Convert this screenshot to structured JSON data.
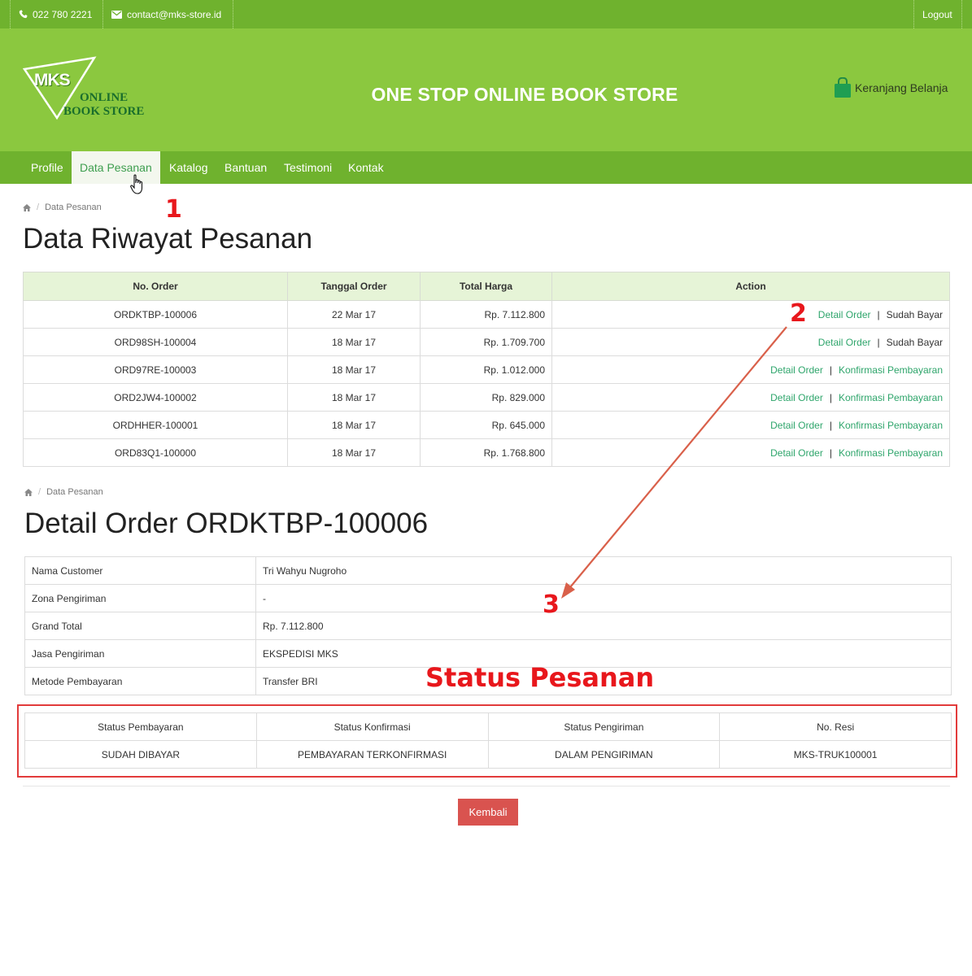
{
  "topbar": {
    "phone": "022 780 2221",
    "email": "contact@mks-store.id",
    "logout": "Logout"
  },
  "header": {
    "logo_mark": "MKS",
    "logo_line1": "ONLINE",
    "logo_line2": "BOOK STORE",
    "tagline": "ONE STOP ONLINE BOOK STORE",
    "cart_label": "Keranjang Belanja"
  },
  "nav": {
    "items": [
      "Profile",
      "Data Pesanan",
      "Katalog",
      "Bantuan",
      "Testimoni",
      "Kontak"
    ],
    "active": "Data Pesanan"
  },
  "breadcrumb": {
    "current": "Data Pesanan"
  },
  "orders_section": {
    "title": "Data Riwayat Pesanan",
    "headers": [
      "No. Order",
      "Tanggal Order",
      "Total Harga",
      "Action"
    ],
    "rows": [
      {
        "no": "ORDKTBP-100006",
        "date": "22 Mar 17",
        "total": "Rp. 7.112.800",
        "detail": "Detail Order",
        "status": "Sudah Bayar"
      },
      {
        "no": "ORD98SH-100004",
        "date": "18 Mar 17",
        "total": "Rp. 1.709.700",
        "detail": "Detail Order",
        "status": "Sudah Bayar"
      },
      {
        "no": "ORD97RE-100003",
        "date": "18 Mar 17",
        "total": "Rp. 1.012.000",
        "detail": "Detail Order",
        "status": "Konfirmasi Pembayaran"
      },
      {
        "no": "ORD2JW4-100002",
        "date": "18 Mar 17",
        "total": "Rp. 829.000",
        "detail": "Detail Order",
        "status": "Konfirmasi Pembayaran"
      },
      {
        "no": "ORDHHER-100001",
        "date": "18 Mar 17",
        "total": "Rp. 645.000",
        "detail": "Detail Order",
        "status": "Konfirmasi Pembayaran"
      },
      {
        "no": "ORD83Q1-100000",
        "date": "18 Mar 17",
        "total": "Rp. 1.768.800",
        "detail": "Detail Order",
        "status": "Konfirmasi Pembayaran"
      }
    ]
  },
  "detail_section": {
    "title": "Detail Order ORDKTBP-100006",
    "fields": [
      {
        "label": "Nama Customer",
        "value": "Tri Wahyu Nugroho"
      },
      {
        "label": "Zona Pengiriman",
        "value": "-"
      },
      {
        "label": "Grand Total",
        "value": "Rp. 7.112.800"
      },
      {
        "label": "Jasa Pengiriman",
        "value": "EKSPEDISI MKS"
      },
      {
        "label": "Metode Pembayaran",
        "value": "Transfer BRI"
      }
    ],
    "status_headers": [
      "Status Pembayaran",
      "Status Konfirmasi",
      "Status Pengiriman",
      "No. Resi"
    ],
    "status_values": [
      "SUDAH DIBAYAR",
      "PEMBAYARAN TERKONFIRMASI",
      "DALAM PENGIRIMAN",
      "MKS-TRUK100001"
    ],
    "back_button": "Kembali"
  },
  "annotations": {
    "n1": "1",
    "n2": "2",
    "n3": "3",
    "title": "Status Pesanan"
  },
  "colors": {
    "topbar": "#6fb22e",
    "header": "#8bc83f",
    "link": "#2ea56b",
    "table_head": "#e6f4d7",
    "annotation": "#e8171c",
    "button": "#d9534f"
  }
}
